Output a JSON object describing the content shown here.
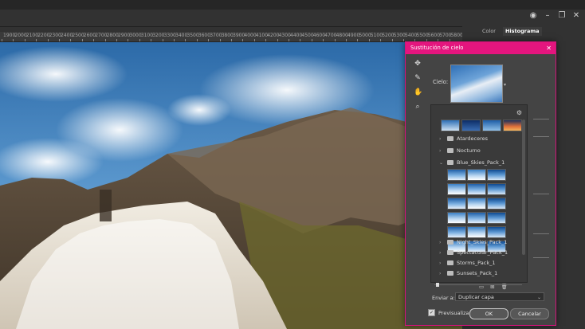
{
  "window": {
    "controls": [
      "user-icon",
      "minimize-icon",
      "restore-icon",
      "close-icon"
    ]
  },
  "ruler": {
    "ticks": [
      "1900",
      "2000",
      "2100",
      "2200",
      "2300",
      "2400",
      "2500",
      "2600",
      "2700",
      "2800",
      "2900",
      "3000",
      "3100",
      "3200",
      "3300",
      "3400",
      "3500",
      "3600",
      "3700",
      "3800",
      "3900",
      "4000",
      "4100",
      "4200",
      "4300",
      "4400",
      "4500",
      "4600",
      "4700",
      "4800",
      "4900",
      "5000",
      "5100",
      "5200",
      "5300",
      "5400",
      "5500",
      "5600",
      "5700",
      "5800",
      "5900"
    ]
  },
  "panels": {
    "tabs": [
      {
        "label": "Color"
      },
      {
        "label": "Histograma"
      }
    ]
  },
  "dialog": {
    "title": "Sustitución de cielo",
    "sky_label": "Cielo:",
    "folders_top": [
      {
        "label": "Atardeceres",
        "expanded": false
      },
      {
        "label": "Nocturno",
        "expanded": false
      },
      {
        "label": "Blue_Skies_Pack_1",
        "expanded": true
      }
    ],
    "folders_bottom": [
      {
        "label": "Night_Skies_Pack_1"
      },
      {
        "label": "Spectacular_Pack_1"
      },
      {
        "label": "Storms_Pack_1"
      },
      {
        "label": "Sunsets_Pack_1"
      }
    ],
    "send_label": "Enviar a:",
    "send_value": "Duplicar capa",
    "preview_label": "Previsualizar",
    "ok_label": "OK",
    "cancel_label": "Cancelar"
  },
  "colors": {
    "dialog_title_bg": "#e4157e",
    "app_bg": "#323232"
  }
}
